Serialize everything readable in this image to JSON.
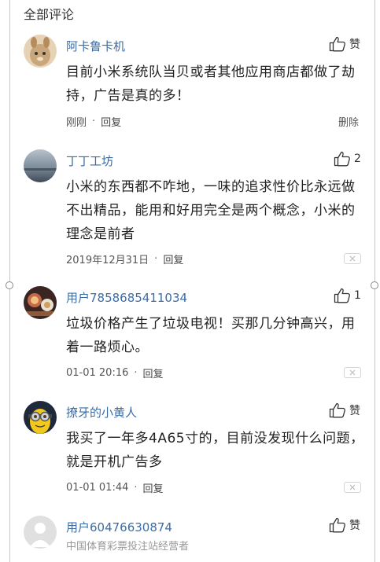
{
  "section_title": "全部评论",
  "comments": [
    {
      "username": "阿卡鲁卡机",
      "like_label": "赞",
      "text": "目前小米系统队当贝或者其他应用商店都做了劫持，广告是真的多！",
      "time": "刚刚",
      "reply_label": "回复",
      "delete_label": "删除",
      "avatar_color": "#c9a77a"
    },
    {
      "username": "丁丁工坊",
      "like_label": "2",
      "text": "小米的东西都不咋地，一味的追求性价比永远做不出精品，能用和好用完全是两个概念，小米的理念是前者",
      "time": "2019年12月31日",
      "reply_label": "回复",
      "avatar_color": "#8a9aa8"
    },
    {
      "username": "用户7858685411034",
      "like_label": "1",
      "text": "垃圾价格产生了垃圾电视！买那几分钟高兴，用着一路烦心。",
      "time": "01-01 20:16",
      "reply_label": "回复",
      "avatar_color": "#7a4a3a"
    },
    {
      "username": "撩牙的小黄人",
      "like_label": "赞",
      "text": "我买了一年多4A65寸的，目前没发现什么问题，就是开机广告多",
      "time": "01-01 01:44",
      "reply_label": "回复",
      "avatar_color": "#2d2d2d"
    },
    {
      "username": "用户60476630874",
      "like_label": "赞",
      "subtitle": "中国体育彩票投注站经营者",
      "avatar_color": "#d9d9d9"
    }
  ],
  "icons": {
    "like": "thumbs-up-icon",
    "close": "close-icon"
  },
  "colors": {
    "username": "#3b6da5",
    "meta": "#555555"
  }
}
